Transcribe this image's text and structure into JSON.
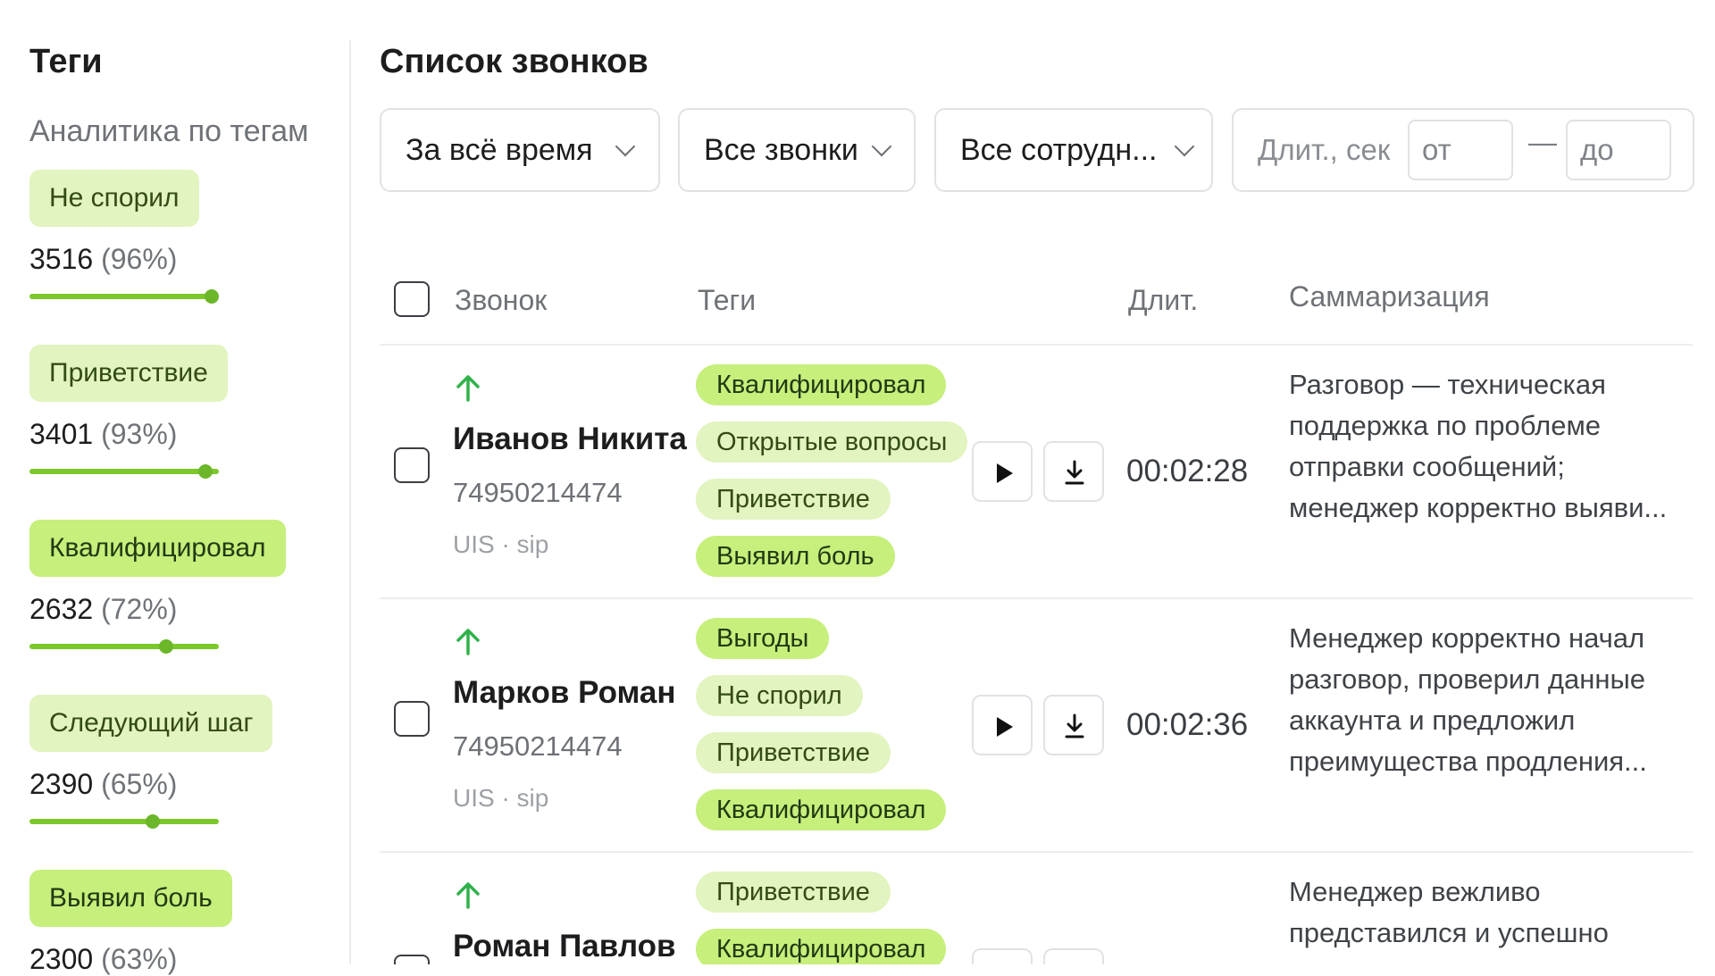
{
  "sidebar": {
    "title": "Теги",
    "subtitle": "Аналитика по тегам",
    "tags": [
      {
        "label": "Не спорил",
        "count": "3516",
        "pct": "(96%)",
        "share": 0.96,
        "style": "light"
      },
      {
        "label": "Приветствие",
        "count": "3401",
        "pct": "(93%)",
        "share": 0.93,
        "style": "light"
      },
      {
        "label": "Квалифицировал",
        "count": "2632",
        "pct": "(72%)",
        "share": 0.72,
        "style": "strong"
      },
      {
        "label": "Следующий шаг",
        "count": "2390",
        "pct": "(65%)",
        "share": 0.65,
        "style": "light"
      },
      {
        "label": "Выявил боль",
        "count": "2300",
        "pct": "(63%)",
        "share": 0.63,
        "style": "strong"
      }
    ]
  },
  "main": {
    "title": "Список звонков",
    "filters": {
      "period": "За всё время",
      "calls": "Все звонки",
      "employees": "Все сотрудн...",
      "duration_label": "Длит., сек",
      "from_placeholder": "от",
      "dash": "—",
      "to_placeholder": "до"
    },
    "columns": {
      "call": "Звонок",
      "tags": "Теги",
      "duration": "Длит.",
      "summary": "Саммаризация"
    },
    "rows": [
      {
        "name": "Иванов Никита",
        "phone": "74950214474",
        "source": "UIS · sip",
        "tags": [
          {
            "label": "Квалифицировал",
            "style": "strong"
          },
          {
            "label": "Открытые вопросы",
            "style": "light"
          },
          {
            "label": "Приветствие",
            "style": "light"
          },
          {
            "label": "Выявил боль",
            "style": "strong"
          }
        ],
        "duration": "00:02:28",
        "summary": [
          "Разговор — техническая",
          "поддержка по проблеме",
          "отправки сообщений;",
          "менеджер корректно выяви..."
        ]
      },
      {
        "name": "Марков Роман",
        "phone": "74950214474",
        "source": "UIS · sip",
        "tags": [
          {
            "label": "Выгоды",
            "style": "strong"
          },
          {
            "label": "Не спорил",
            "style": "light"
          },
          {
            "label": "Приветствие",
            "style": "light"
          },
          {
            "label": "Квалифицировал",
            "style": "strong"
          }
        ],
        "duration": "00:02:36",
        "summary": [
          "Менеджер корректно начал",
          "разговор, проверил данные",
          "аккаунта и предложил",
          "преимущества продления..."
        ]
      },
      {
        "name": "Роман Павлов",
        "phone": "",
        "source": "",
        "tags": [
          {
            "label": "Приветствие",
            "style": "light"
          },
          {
            "label": "Квалифицировал",
            "style": "strong"
          }
        ],
        "duration": "",
        "summary": [
          "Менеджер вежливо",
          "представился и успешно"
        ]
      }
    ]
  },
  "colors": {
    "tag_light": "#e2f4bf",
    "tag_strong": "#c6ef7c",
    "bar": "#7cc82a",
    "arrow": "#2fb24a"
  }
}
